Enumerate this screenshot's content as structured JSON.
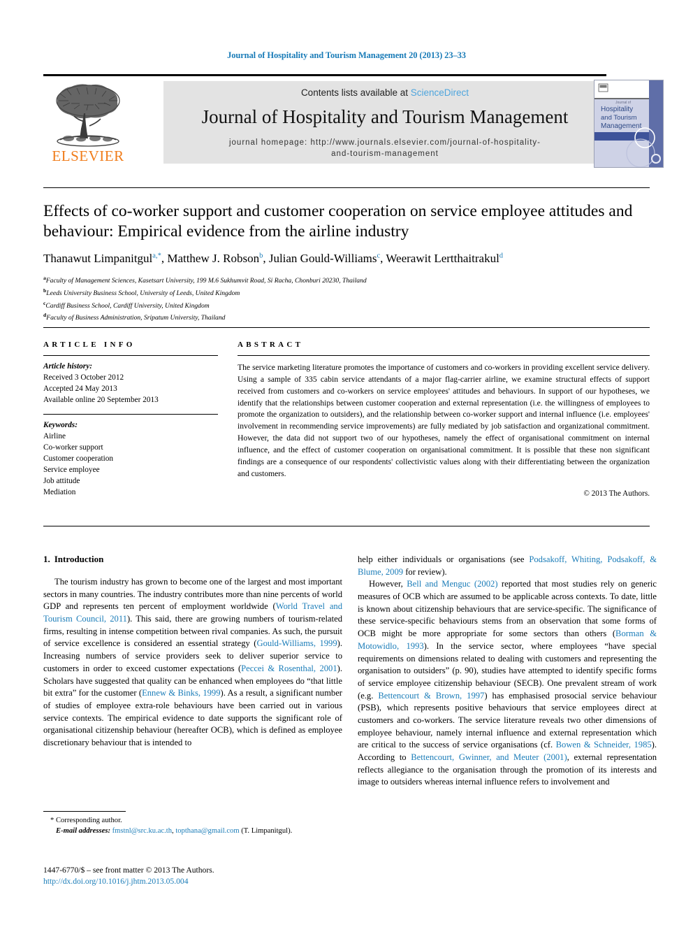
{
  "running_head": "Journal of Hospitality and Tourism Management 20 (2013) 23–33",
  "masthead": {
    "publisher_name": "ELSEVIER",
    "contents_prefix": "Contents lists available at ",
    "contents_link": "ScienceDirect",
    "journal_name": "Journal of Hospitality and Tourism Management",
    "homepage_line1": "journal homepage: http://www.journals.elsevier.com/journal-of-hospitality-",
    "homepage_line2": "and-tourism-management",
    "cover": {
      "line1": "Journal of",
      "line2": "Hospitality",
      "line3": "and Tourism",
      "line4": "Management"
    }
  },
  "article": {
    "title": "Effects of co-worker support and customer cooperation on service employee attitudes and behaviour: Empirical evidence from the airline industry",
    "authors": [
      {
        "name": "Thanawut Limpanitgul",
        "marks": "a,*"
      },
      {
        "name": "Matthew J. Robson",
        "marks": "b"
      },
      {
        "name": "Julian Gould-Williams",
        "marks": "c"
      },
      {
        "name": "Weerawit Lertthaitrakul",
        "marks": "d"
      }
    ],
    "affiliations": [
      {
        "mark": "a",
        "text": "Faculty of Management Sciences, Kasetsart University, 199 M.6 Sukhumvit Road, Si Racha, Chonburi 20230, Thailand"
      },
      {
        "mark": "b",
        "text": "Leeds University Business School, University of Leeds, United Kingdom"
      },
      {
        "mark": "c",
        "text": "Cardiff Business School, Cardiff University, United Kingdom"
      },
      {
        "mark": "d",
        "text": "Faculty of Business Administration, Sripatum University, Thailand"
      }
    ]
  },
  "article_info": {
    "heading": "ARTICLE INFO",
    "history_label": "Article history:",
    "history": [
      "Received 3 October 2012",
      "Accepted 24 May 2013",
      "Available online 20 September 2013"
    ],
    "keywords_label": "Keywords:",
    "keywords": [
      "Airline",
      "Co-worker support",
      "Customer cooperation",
      "Service employee",
      "Job attitude",
      "Mediation"
    ]
  },
  "abstract": {
    "heading": "ABSTRACT",
    "text": "The service marketing literature promotes the importance of customers and co-workers in providing excellent service delivery. Using a sample of 335 cabin service attendants of a major flag-carrier airline, we examine structural effects of support received from customers and co-workers on service employees' attitudes and behaviours. In support of our hypotheses, we identify that the relationships between customer cooperation and external representation (i.e. the willingness of employees to promote the organization to outsiders), and the relationship between co-worker support and internal influence (i.e. employees' involvement in recommending service improvements) are fully mediated by job satisfaction and organizational commitment. However, the data did not support two of our hypotheses, namely the effect of organisational commitment on internal influence, and the effect of customer cooperation on organisational commitment. It is possible that these non significant findings are a consequence of our respondents' collectivistic values along with their differentiating between the organization and customers.",
    "copyright": "© 2013 The Authors."
  },
  "introduction": {
    "number": "1.",
    "heading": "Introduction",
    "left_para_1_a": "The tourism industry has grown to become one of the largest and most important sectors in many countries. The industry contributes more than nine percents of world GDP and represents ten percent of employment worldwide (",
    "left_ref_1": "World Travel and Tourism Council, 2011",
    "left_para_1_b": "). This said, there are growing numbers of tourism-related firms, resulting in intense competition between rival companies. As such, the pursuit of service excellence is considered an essential strategy (",
    "left_ref_2": "Gould-Williams, 1999",
    "left_para_1_c": "). Increasing numbers of service providers seek to deliver superior service to customers in order to exceed customer expectations (",
    "left_ref_3": "Peccei & Rosenthal, 2001",
    "left_para_1_d": "). Scholars have suggested that quality can be enhanced when employees do “that little bit extra” for the customer (",
    "left_ref_4": "Ennew & Binks, 1999",
    "left_para_1_e": "). As a result, a significant number of studies of employee extra-role behaviours have been carried out in various service contexts. The empirical evidence to date supports the significant role of organisational citizenship behaviour (hereafter OCB), which is defined as employee discretionary behaviour that is intended to",
    "right_para_1_a": "help either individuals or organisations (see ",
    "right_ref_1": "Podsakoff, Whiting, Podsakoff, & Blume, 2009",
    "right_para_1_b": " for review).",
    "right_para_2_a": "However, ",
    "right_ref_2": "Bell and Menguc (2002)",
    "right_para_2_b": " reported that most studies rely on generic measures of OCB which are assumed to be applicable across contexts. To date, little is known about citizenship behaviours that are service-specific. The significance of these service-specific behaviours stems from an observation that some forms of OCB might be more appropriate for some sectors than others (",
    "right_ref_3": "Borman & Motowidlo, 1993",
    "right_para_2_c": "). In the service sector, where employees “have special requirements on dimensions related to dealing with customers and representing the organisation to outsiders” (p. 90), studies have attempted to identify specific forms of service employee citizenship behaviour (SECB). One prevalent stream of work (e.g. ",
    "right_ref_4": "Bettencourt & Brown, 1997",
    "right_para_2_d": ") has emphasised prosocial service behaviour (PSB), which represents positive behaviours that service employees direct at customers and co-workers. The service literature reveals two other dimensions of employee behaviour, namely internal influence and external representation which are critical to the success of service organisations (cf. ",
    "right_ref_5": "Bowen & Schneider, 1985",
    "right_para_2_e": "). According to ",
    "right_ref_6": "Bettencourt, Gwinner, and Meuter (2001)",
    "right_para_2_f": ", external representation reflects allegiance to the organisation through the promotion of its interests and image to outsiders whereas internal influence refers to involvement and"
  },
  "footnote": {
    "corresponding": "* Corresponding author.",
    "email_label": "E-mail addresses:",
    "email1": "fmstnl@src.ku.ac.th",
    "email_sep": ", ",
    "email2": "topthana@gmail.com",
    "email_suffix": " (T. Limpanitgul)."
  },
  "issn": {
    "line": "1447-6770/$ – see front matter © 2013 The Authors.",
    "doi": "http://dx.doi.org/10.1016/j.jhtm.2013.05.004"
  },
  "colors": {
    "link_blue": "#1a7cb8",
    "sciencedirect_blue": "#4ea5dd",
    "elsevier_orange": "#f07c1a",
    "band_grey": "#e3e3e3"
  }
}
